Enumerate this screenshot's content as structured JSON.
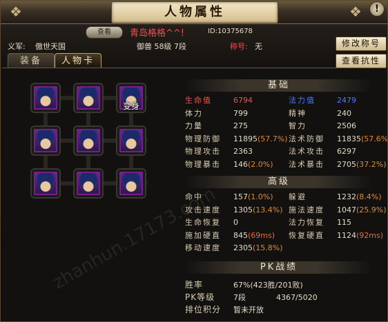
{
  "window": {
    "title": "人物属性",
    "close_label": "!"
  },
  "header": {
    "back_label": "查看",
    "player_name": "青岛格格^^!",
    "player_id": "ID:10375678",
    "guild_label": "义军:",
    "guild_name": "傲世天国",
    "level_info": "御兽 58级 7段",
    "honor_label": "称号:",
    "honor_value": "无",
    "rename_button": "修改称号",
    "resist_button": "查看抗性"
  },
  "tabs": [
    {
      "label": "装备",
      "active": false
    },
    {
      "label": "人物卡",
      "active": true
    }
  ],
  "card_grid": {
    "slots": [
      {
        "label": ""
      },
      {
        "label": ""
      },
      {
        "label": "变身"
      },
      {
        "label": ""
      },
      {
        "label": ""
      },
      {
        "label": ""
      },
      {
        "label": ""
      },
      {
        "label": ""
      },
      {
        "label": ""
      }
    ]
  },
  "sections": {
    "basic": "基础",
    "advanced": "高级",
    "pk": "PK战绩"
  },
  "basic": [
    {
      "l1": "生命值",
      "v1": "6794",
      "p1": "",
      "l2": "法力值",
      "v2": "2479",
      "p2": ""
    },
    {
      "l1": "体力",
      "v1": "799",
      "p1": "",
      "l2": "精神",
      "v2": "240",
      "p2": ""
    },
    {
      "l1": "力量",
      "v1": "275",
      "p1": "",
      "l2": "智力",
      "v2": "2506",
      "p2": ""
    },
    {
      "l1": "物理防御",
      "v1": "11895",
      "p1": "(57.7%)",
      "l2": "法术防御",
      "v2": "11835",
      "p2": "(57.6%)"
    },
    {
      "l1": "物理攻击",
      "v1": "2363",
      "p1": "",
      "l2": "法术攻击",
      "v2": "6297",
      "p2": ""
    },
    {
      "l1": "物理暴击",
      "v1": "146",
      "p1": "(2.0%)",
      "l2": "法术暴击",
      "v2": "2705",
      "p2": "(37.2%)"
    }
  ],
  "advanced": [
    {
      "l1": "命中",
      "v1": "157",
      "p1": "(1.0%)",
      "l2": "躲避",
      "v2": "1232",
      "p2": "(8.4%)"
    },
    {
      "l1": "攻击速度",
      "v1": "1305",
      "p1": "(13.4%)",
      "l2": "施法速度",
      "v2": "1047",
      "p2": "(25.9%)"
    },
    {
      "l1": "生命恢复",
      "v1": "0",
      "p1": "",
      "l2": "法力恢复",
      "v2": "115",
      "p2": ""
    },
    {
      "l1": "施加硬直",
      "v1": "845",
      "p1": "(69ms)",
      "l2": "恢复硬直",
      "v2": "1124",
      "p2": "(92ms)"
    },
    {
      "l1": "移动速度",
      "v1": "2305",
      "p1": "(15.8%)",
      "l2": "",
      "v2": "",
      "p2": ""
    }
  ],
  "pk": {
    "win_label": "胜率",
    "win_value": "67%(423胜/201败)",
    "rank_label": "PK等级",
    "rank_value": "7段",
    "rank_points": "4367/5020",
    "ladder_label": "排位积分",
    "ladder_value": "暂未开放"
  },
  "watermark": "zhanhun.17173.com"
}
